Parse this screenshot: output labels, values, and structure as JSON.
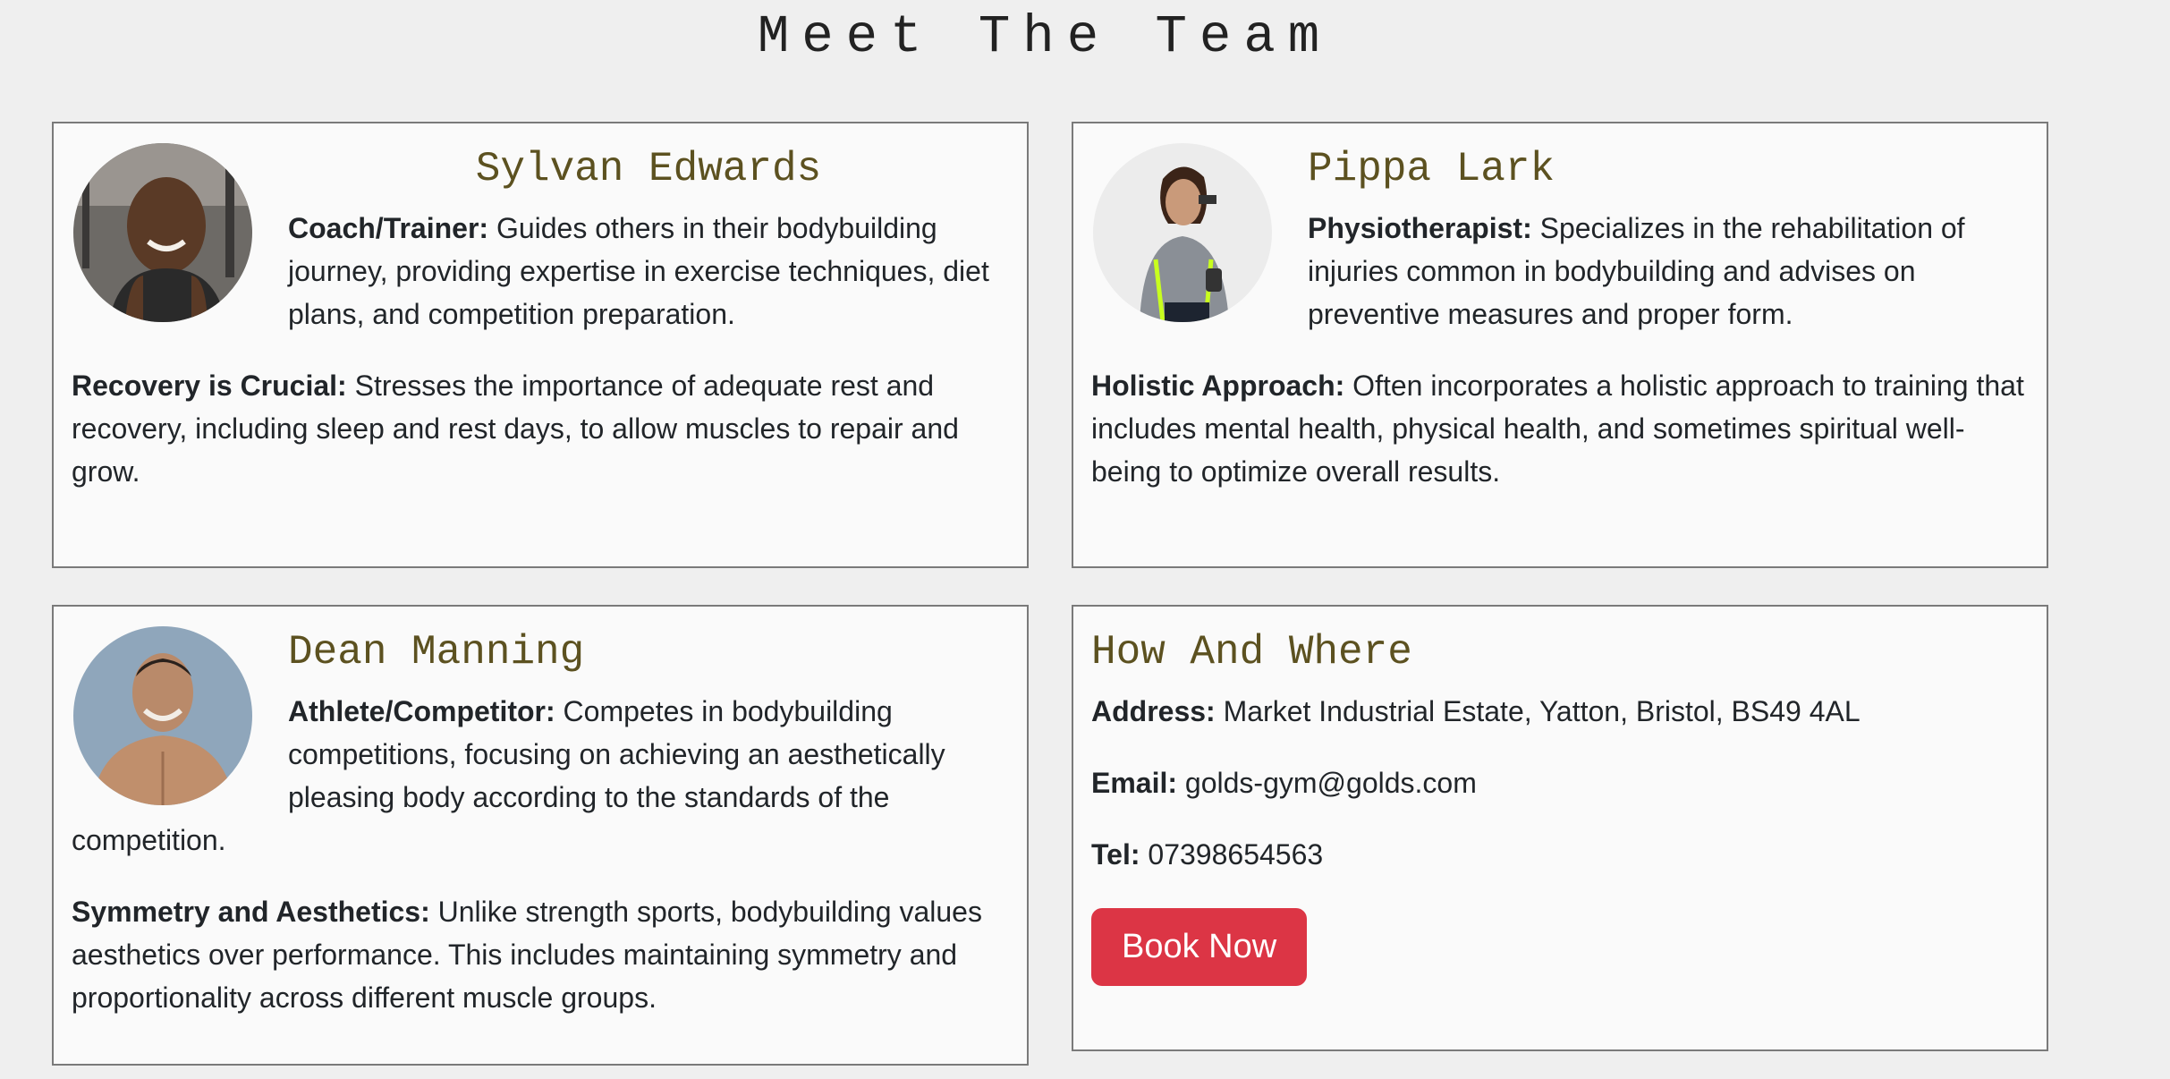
{
  "page": {
    "title": "Meet The Team"
  },
  "members": [
    {
      "name": "Sylvan Edwards",
      "role_label": "Coach/Trainer:",
      "role_text": " Guides others in their bodybuilding journey, providing expertise in exercise techniques, diet plans, and competition preparation.",
      "point_label": "Recovery is Crucial:",
      "point_text": " Stresses the importance of adequate rest and recovery, including sleep and rest days, to allow muscles to repair and grow."
    },
    {
      "name": "Pippa Lark",
      "role_label": "Physiotherapist:",
      "role_text": " Specializes in the rehabilitation of injuries common in bodybuilding and advises on preventive measures and proper form.",
      "point_label": "Holistic Approach:",
      "point_text": " Often incorporates a holistic approach to training that includes mental health, physical health, and sometimes spiritual well-being to optimize overall results."
    },
    {
      "name": "Dean Manning",
      "role_label": "Athlete/Competitor:",
      "role_text": " Competes in bodybuilding competitions, focusing on achieving an aesthetically pleasing body according to the standards of the competition.",
      "point_label": "Symmetry and Aesthetics:",
      "point_text": " Unlike strength sports, bodybuilding values aesthetics over performance. This includes maintaining symmetry and proportionality across different muscle groups."
    }
  ],
  "contact": {
    "title": "How And Where",
    "address_label": "Address:",
    "address": " Market Industrial Estate, Yatton, Bristol, BS49 4AL",
    "email_label": "Email:",
    "email": " golds-gym@golds.com",
    "tel_label": "Tel:",
    "tel": " 07398654563",
    "button": "Book Now",
    "button_color": "#dc3545"
  },
  "colors": {
    "heading": "#5c5120",
    "background": "#efefef",
    "card": "#fafafa"
  }
}
